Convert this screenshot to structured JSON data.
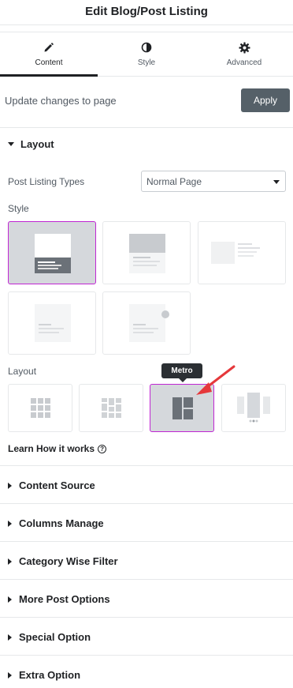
{
  "header": {
    "title": "Edit Blog/Post Listing"
  },
  "tabs": [
    {
      "label": "Content",
      "icon": "pencil-icon",
      "active": true
    },
    {
      "label": "Style",
      "icon": "contrast-icon",
      "active": false
    },
    {
      "label": "Advanced",
      "icon": "gear-icon",
      "active": false
    }
  ],
  "update": {
    "text": "Update changes to page",
    "apply_label": "Apply"
  },
  "layout_section": {
    "title": "Layout",
    "post_types_label": "Post Listing Types",
    "post_types_value": "Normal Page",
    "style_label": "Style",
    "layout_label": "Layout",
    "tooltip": "Metro",
    "learn_label": "Learn How it works",
    "selected_style": 1,
    "selected_layout": 3
  },
  "sections": [
    {
      "title": "Content Source"
    },
    {
      "title": "Columns Manage"
    },
    {
      "title": "Category Wise Filter"
    },
    {
      "title": "More Post Options"
    },
    {
      "title": "Special Option"
    },
    {
      "title": "Extra Option"
    }
  ],
  "colors": {
    "accent": "#c026d3",
    "button": "#556068",
    "arrow": "#e5383b"
  }
}
